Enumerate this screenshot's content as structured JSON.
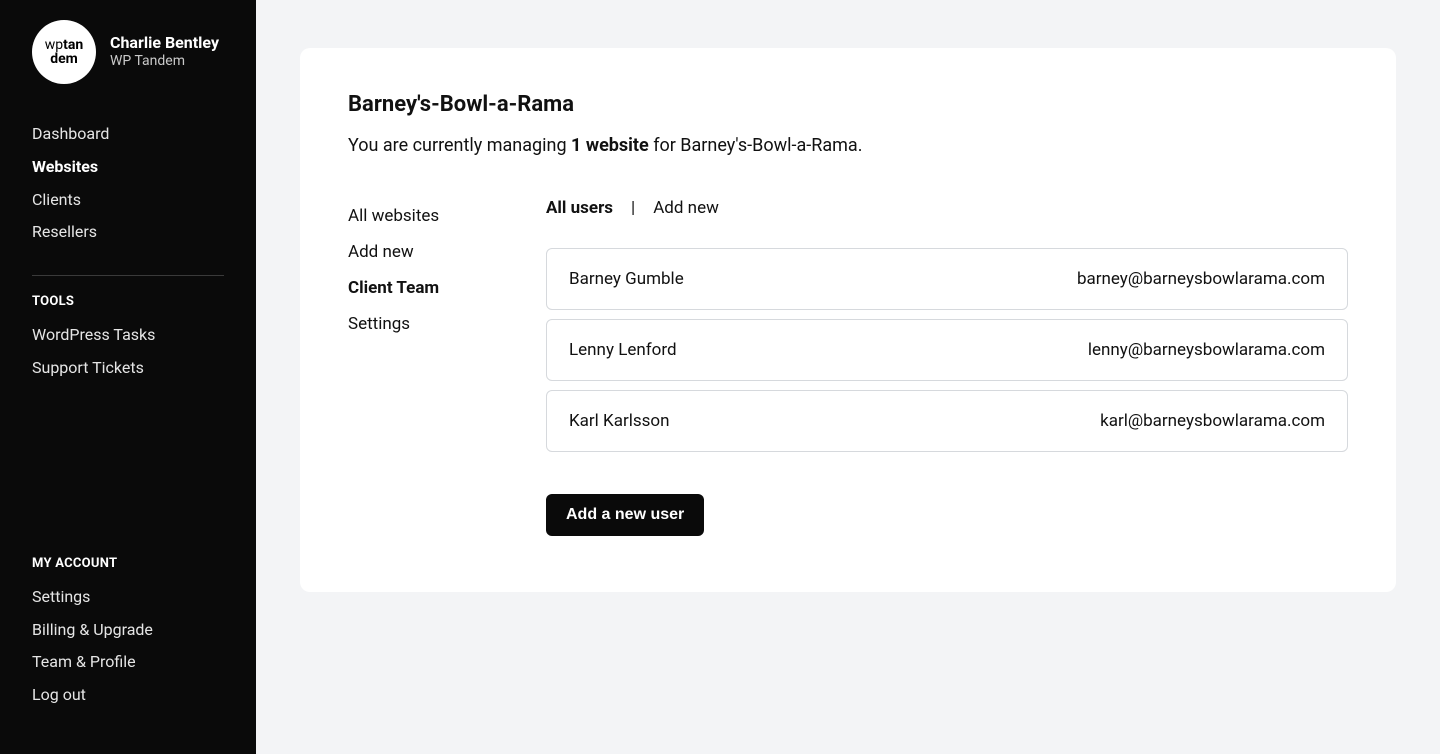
{
  "sidebar": {
    "logo_top": "wp",
    "logo_bold1": "tan",
    "logo_bold2": "dem",
    "user_name": "Charlie Bentley",
    "user_company": "WP Tandem",
    "nav_primary": [
      {
        "label": "Dashboard",
        "name": "sidebar-item-dashboard",
        "active": false
      },
      {
        "label": "Websites",
        "name": "sidebar-item-websites",
        "active": true
      },
      {
        "label": "Clients",
        "name": "sidebar-item-clients",
        "active": false
      },
      {
        "label": "Resellers",
        "name": "sidebar-item-resellers",
        "active": false
      }
    ],
    "tools_heading": "TOOLS",
    "nav_tools": [
      {
        "label": "WordPress Tasks",
        "name": "sidebar-item-wordpress-tasks"
      },
      {
        "label": "Support Tickets",
        "name": "sidebar-item-support-tickets"
      }
    ],
    "account_heading": "MY ACCOUNT",
    "nav_account": [
      {
        "label": "Settings",
        "name": "sidebar-item-settings"
      },
      {
        "label": "Billing & Upgrade",
        "name": "sidebar-item-billing"
      },
      {
        "label": "Team & Profile",
        "name": "sidebar-item-team-profile"
      },
      {
        "label": "Log out",
        "name": "sidebar-item-logout"
      }
    ]
  },
  "main": {
    "title": "Barney's-Bowl-a-Rama",
    "subtext_prefix": "You are currently managing ",
    "subtext_bold": "1 website",
    "subtext_suffix": " for Barney's-Bowl-a-Rama.",
    "subnav": [
      {
        "label": "All websites",
        "name": "subnav-all-websites",
        "active": false
      },
      {
        "label": "Add new",
        "name": "subnav-add-new",
        "active": false
      },
      {
        "label": "Client Team",
        "name": "subnav-client-team",
        "active": true
      },
      {
        "label": "Settings",
        "name": "subnav-settings",
        "active": false
      }
    ],
    "panel_tabs": {
      "all_users": "All users",
      "separator": "|",
      "add_new": "Add new"
    },
    "users": [
      {
        "name": "Barney Gumble",
        "email": "barney@barneysbowlarama.com"
      },
      {
        "name": "Lenny Lenford",
        "email": "lenny@barneysbowlarama.com"
      },
      {
        "name": "Karl Karlsson",
        "email": "karl@barneysbowlarama.com"
      }
    ],
    "add_user_button": "Add a new user"
  }
}
